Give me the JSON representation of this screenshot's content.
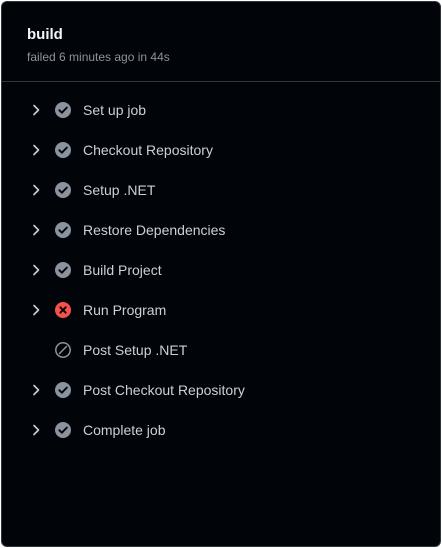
{
  "job": {
    "title": "build",
    "status_text": "failed 6 minutes ago in 44s"
  },
  "colors": {
    "background": "#010409",
    "success": "#8b949e",
    "failure": "#f85149",
    "text": "#c9d1d9",
    "muted": "#8b949e"
  },
  "steps": [
    {
      "label": "Set up job",
      "status": "success",
      "icon": "check-circle-icon",
      "expandable": true
    },
    {
      "label": "Checkout Repository",
      "status": "success",
      "icon": "check-circle-icon",
      "expandable": true
    },
    {
      "label": "Setup .NET",
      "status": "success",
      "icon": "check-circle-icon",
      "expandable": true
    },
    {
      "label": "Restore Dependencies",
      "status": "success",
      "icon": "check-circle-icon",
      "expandable": true
    },
    {
      "label": "Build Project",
      "status": "success",
      "icon": "check-circle-icon",
      "expandable": true
    },
    {
      "label": "Run Program",
      "status": "failure",
      "icon": "x-circle-icon",
      "expandable": true
    },
    {
      "label": "Post Setup .NET",
      "status": "skipped",
      "icon": "skip-icon",
      "expandable": false
    },
    {
      "label": "Post Checkout Repository",
      "status": "success",
      "icon": "check-circle-icon",
      "expandable": true
    },
    {
      "label": "Complete job",
      "status": "success",
      "icon": "check-circle-icon",
      "expandable": true
    }
  ]
}
